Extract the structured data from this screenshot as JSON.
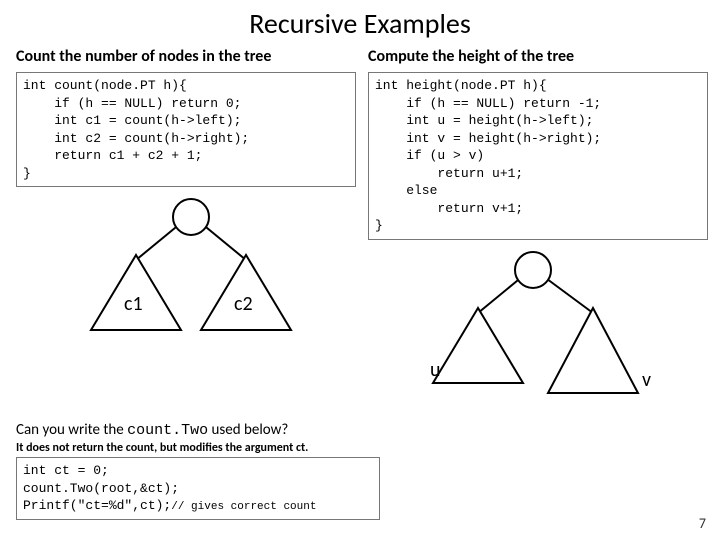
{
  "title": "Recursive Examples",
  "left": {
    "subhead": "Count the number of nodes in the tree",
    "code": "int count(node.PT h){\n    if (h == NULL) return 0;\n    int c1 = count(h->left);\n    int c2 = count(h->right);\n    return c1 + c2 + 1;\n}",
    "tree": {
      "label_left": "c1",
      "label_right": "c2"
    }
  },
  "right": {
    "subhead": "Compute the height of the tree",
    "code": "int height(node.PT h){\n    if (h == NULL) return -1;\n    int u = height(h->left);\n    int v = height(h->right);\n    if (u > v)\n        return u+1;\n    else\n        return v+1;\n}",
    "tree": {
      "label_left": "u",
      "label_right": "v"
    }
  },
  "question_prefix": "Can you write the ",
  "question_func": "count.Two",
  "question_suffix": " used below?",
  "note": "It does not return the count, but modifies the argument ct.",
  "code2_line1": "int ct = 0;",
  "code2_line2": "count.Two(root,&ct);",
  "code2_line3a": "Printf(\"ct=%d\",ct);",
  "code2_line3b": "// gives correct count",
  "pagenum": "7"
}
